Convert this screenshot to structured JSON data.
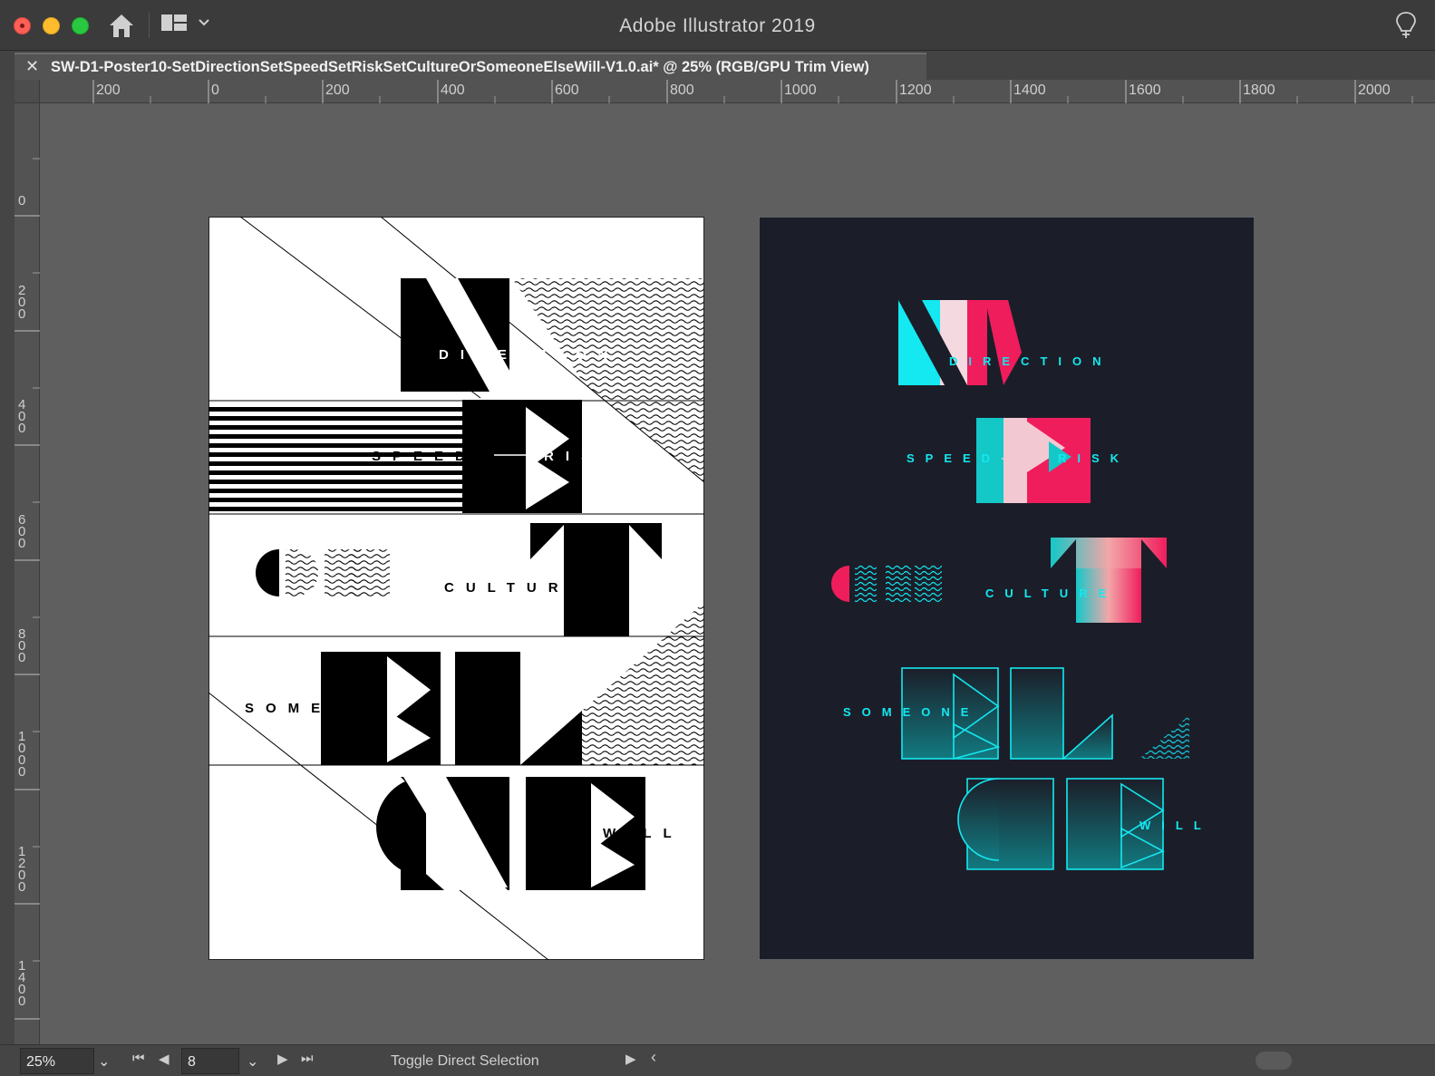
{
  "app": {
    "title": "Adobe Illustrator 2019"
  },
  "document": {
    "tab_title": "SW-D1-Poster10-SetDirectionSetSpeedSetRiskSetCultureOrSomeoneElseWill-V1.0.ai* @ 25% (RGB/GPU Trim View)",
    "close_glyph": "✕"
  },
  "rulers": {
    "h_labels": [
      "200",
      "0",
      "200",
      "400",
      "600",
      "800",
      "1000",
      "1200",
      "1400",
      "1600",
      "1800",
      "2000"
    ],
    "v_labels": [
      "0",
      "200",
      "400",
      "600",
      "800",
      "1000",
      "1200",
      "1400"
    ]
  },
  "poster_words": {
    "direction": "DIRECTION",
    "speed": "SPEED",
    "risk": "RISK",
    "culture": "CULTURE",
    "someone": "SOMEONE",
    "will": "WILL"
  },
  "status": {
    "zoom": "25%",
    "artboard_number": "8",
    "tool_hint": "Toggle Direct Selection"
  },
  "icons": [
    "home-icon",
    "workspace-switcher-icon",
    "lightbulb-icon",
    "close-icon",
    "first-artboard-icon",
    "prev-artboard-icon",
    "next-artboard-icon",
    "last-artboard-icon"
  ],
  "colors": {
    "cyan": "#14e8f0",
    "pink": "#ef1d5c",
    "navy": "#1b1e29"
  }
}
